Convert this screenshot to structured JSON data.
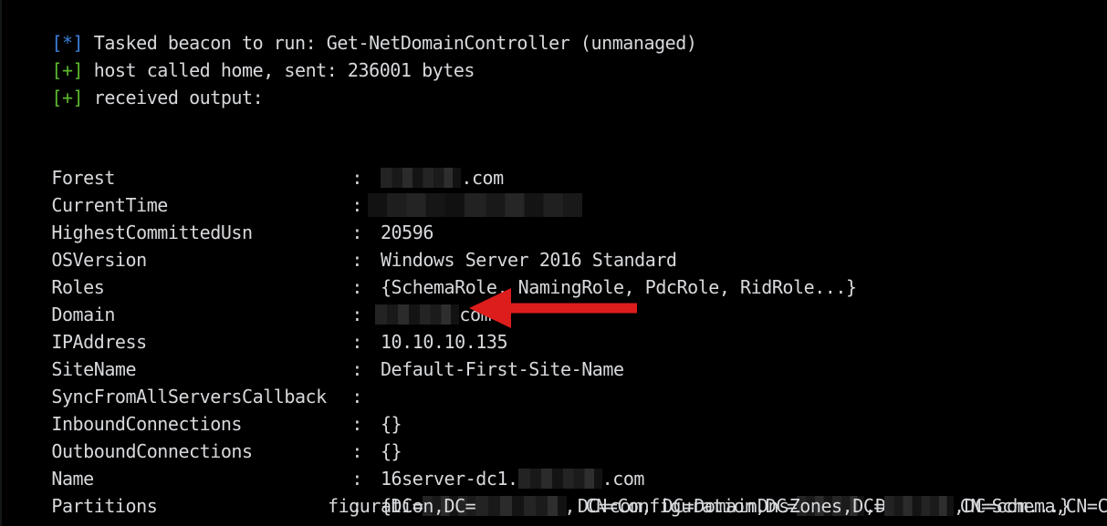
{
  "terminal": {
    "background_color": "#000000",
    "text_color": "#d7d9dc",
    "info_tag_color": "#3b7dd8",
    "success_tag_color": "#5cb82e",
    "annotation_color": "#dd1c1c"
  },
  "log_lines": [
    {
      "tag": "[*]",
      "tag_kind": "info",
      "text": " Tasked beacon to run: Get-NetDomainController (unmanaged)"
    },
    {
      "tag": "[+]",
      "tag_kind": "success",
      "text": " host called home, sent: 236001 bytes"
    },
    {
      "tag": "[+]",
      "tag_kind": "success",
      "text": " received output:"
    }
  ],
  "properties": [
    {
      "key": "Forest",
      "colon": ":",
      "value_prefix": "",
      "redacted": true,
      "value_suffix": ".com"
    },
    {
      "key": "CurrentTime",
      "colon": ":",
      "value_prefix": "",
      "redacted": true,
      "value_suffix": ""
    },
    {
      "key": "HighestCommittedUsn",
      "colon": ":",
      "value_prefix": " 20596",
      "redacted": false,
      "value_suffix": ""
    },
    {
      "key": "OSVersion",
      "colon": ":",
      "value_prefix": " Windows Server 2016 Standard",
      "redacted": false,
      "value_suffix": ""
    },
    {
      "key": "Roles",
      "colon": ":",
      "value_prefix": " {SchemaRole, NamingRole, PdcRole, RidRole...}",
      "redacted": false,
      "value_suffix": ""
    },
    {
      "key": "Domain",
      "colon": ":",
      "value_prefix": "",
      "redacted": true,
      "value_suffix": "com"
    },
    {
      "key": "IPAddress",
      "colon": ":",
      "value_prefix": " 10.10.10.135",
      "redacted": false,
      "value_suffix": ""
    },
    {
      "key": "SiteName",
      "colon": ":",
      "value_prefix": " Default-First-Site-Name",
      "redacted": false,
      "value_suffix": ""
    },
    {
      "key": "SyncFromAllServersCallback",
      "colon": ":",
      "value_prefix": "",
      "redacted": false,
      "value_suffix": ""
    },
    {
      "key": "InboundConnections",
      "colon": ":",
      "value_prefix": " {}",
      "redacted": false,
      "value_suffix": ""
    },
    {
      "key": "OutboundConnections",
      "colon": ":",
      "value_prefix": " {}",
      "redacted": false,
      "value_suffix": ""
    },
    {
      "key": "Name",
      "colon": ":",
      "value_prefix": " 16server-dc1.",
      "redacted": true,
      "value_suffix": ".com"
    },
    {
      "key": "Partitions",
      "colon": ":",
      "value_prefix": " {DC=",
      "redacted": true,
      "value_suffix": ",DC=com, CN=Configuration,DC="
    }
  ],
  "partitions_extra": {
    "line1_tail": ",DC=com, CN=Schema,CN=Con",
    "line2_prefix": "figuration,DC=",
    "line2_mid": " DC=com, DC=DomainDnsZones,DC=",
    "line2_tail": ",DC=com...}"
  },
  "annotation": {
    "kind": "left-arrow",
    "label": "red-arrow-pointing-to-ipaddress",
    "color": "#dd1c1c",
    "points_to": "IPAddress value 10.10.10.135"
  }
}
